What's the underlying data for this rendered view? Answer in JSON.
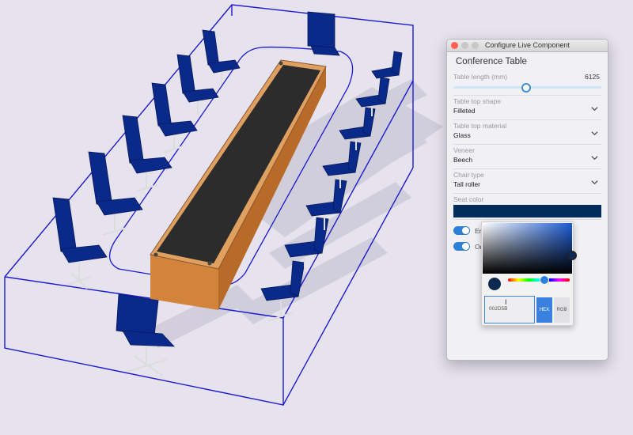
{
  "window": {
    "title": "Configure Live Component"
  },
  "panel": {
    "heading": "Conference Table",
    "length": {
      "label": "Table length (mm)",
      "value": "6125",
      "fraction": 0.49
    },
    "shape": {
      "label": "Table top shape",
      "value": "Filleted"
    },
    "material": {
      "label": "Table top material",
      "value": "Glass"
    },
    "veneer": {
      "label": "Veneer",
      "value": "Beech"
    },
    "chair": {
      "label": "Chair type",
      "value": "Tall roller"
    },
    "seat": {
      "label": "Seat color",
      "color": "#002D5B"
    },
    "toggles": [
      {
        "label": "En"
      },
      {
        "label": "Or"
      }
    ]
  },
  "picker": {
    "hex_value": "002D5B",
    "hex_label": "HEX",
    "rgb_label": "RGB"
  },
  "colors": {
    "accent": "#2e7fd6",
    "selection": "#1d1ad0",
    "chair": "#0a2a8a",
    "wood": "#c9772e",
    "tabletop": "#2c2c2c"
  }
}
